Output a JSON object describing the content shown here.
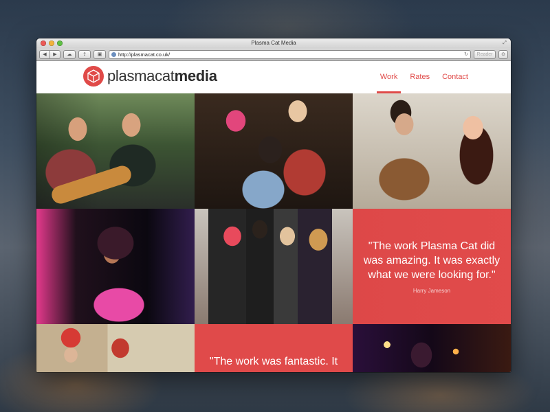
{
  "browser": {
    "window_title": "Plasma Cat Media",
    "url": "http://plasmacat.co.uk/",
    "reader_label": "Reader"
  },
  "site": {
    "logo": {
      "text_light": "plasmacat",
      "text_bold": "media"
    },
    "nav": [
      {
        "label": "Work",
        "active": true
      },
      {
        "label": "Rates",
        "active": false
      },
      {
        "label": "Contact",
        "active": false
      }
    ],
    "accent_color": "#e04a48",
    "testimonials": [
      {
        "quote": "\"The work Plasma Cat did was amazing. It was exactly what we were looking for.\"",
        "author": "Harry Jameson"
      },
      {
        "quote": "\"The work was fantastic. It"
      }
    ]
  }
}
